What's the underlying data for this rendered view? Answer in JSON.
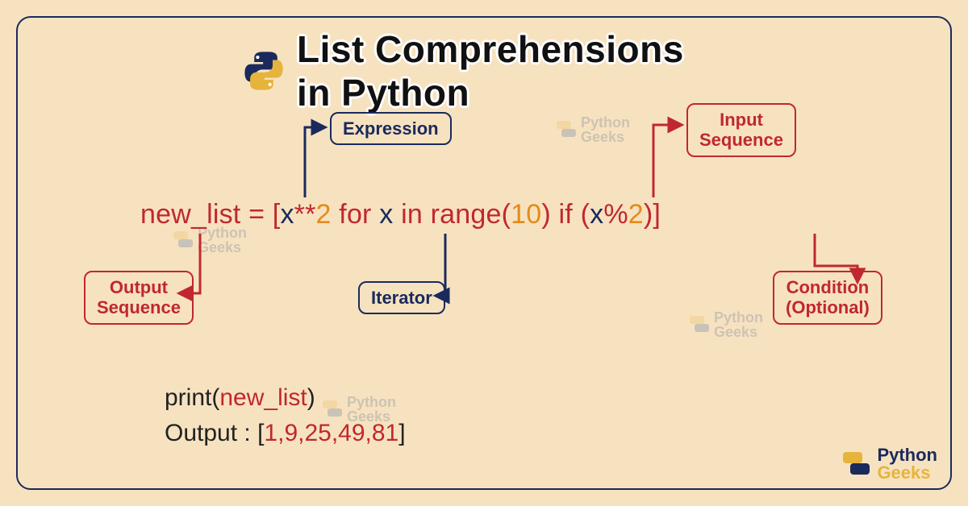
{
  "title": "List Comprehensions in Python",
  "labels": {
    "expression": "Expression",
    "input_sequence": "Input\nSequence",
    "output_sequence": "Output\nSequence",
    "iterator": "Iterator",
    "condition": "Condition\n(Optional)"
  },
  "code": {
    "lhs": "new_list",
    "eq": " = ",
    "lbrack": "[",
    "var1": "x",
    "pow": "**",
    "two": "2",
    "sp1": " ",
    "for": "for",
    "sp2": " ",
    "itervar": "x",
    "sp3": " ",
    "in": "in",
    "sp4": " ",
    "range": "range",
    "lpar1": "(",
    "ten": "10",
    "rpar1": ")",
    "sp5": " ",
    "if": "if",
    "sp6": " ",
    "lpar2": "(",
    "var2": "x",
    "mod": "%",
    "two2": "2",
    "rpar2": ")",
    "rbrack": "]"
  },
  "print": {
    "fn": "print",
    "lpar": "(",
    "arg": "new_list",
    "rpar": ")",
    "out_label": "Output : ",
    "out_l": "[",
    "out_vals": "1,9,25,49,81",
    "out_r": "]"
  },
  "brand": {
    "top": "Python",
    "bot": "Geeks"
  },
  "colors": {
    "bg": "#f7e2c0",
    "navy": "#1a2a5c",
    "red": "#c0282d",
    "orange": "#e38b1a"
  }
}
